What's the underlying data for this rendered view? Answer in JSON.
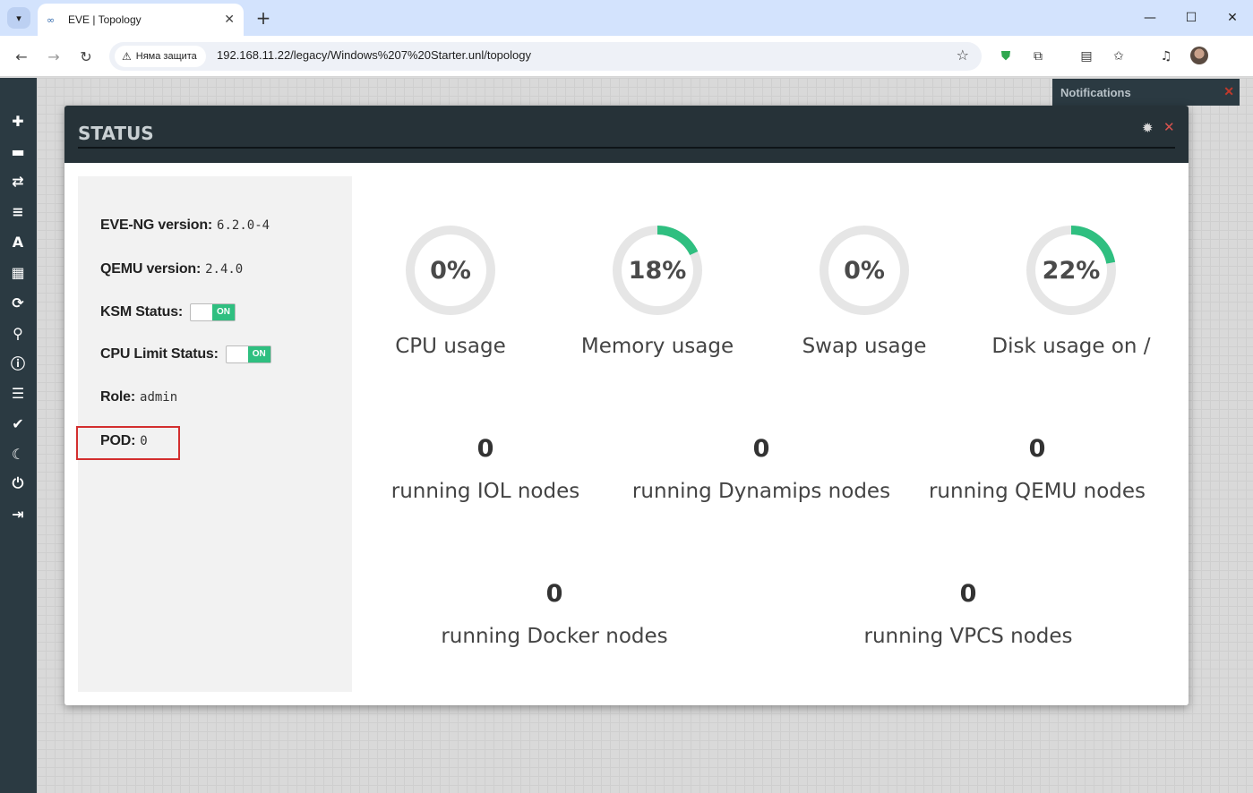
{
  "browser": {
    "tab_title": "EVE | Topology",
    "security_label": "Няма защита",
    "url": "192.168.11.22/legacy/Windows%207%20Starter.unl/topology"
  },
  "notifications": {
    "title": "Notifications"
  },
  "modal": {
    "title": "STATUS",
    "info": {
      "eve_label": "EVE-NG version:",
      "eve_value": "6.2.0-4",
      "qemu_label": "QEMU version:",
      "qemu_value": "2.4.0",
      "ksm_label": "KSM Status:",
      "ksm_toggle": "ON",
      "cpulimit_label": "CPU Limit Status:",
      "cpulimit_toggle": "ON",
      "role_label": "Role:",
      "role_value": "admin",
      "pod_label": "POD:",
      "pod_value": "0"
    },
    "gauges": [
      {
        "value_text": "0%",
        "percent": 0,
        "label": "CPU usage"
      },
      {
        "value_text": "18%",
        "percent": 18,
        "label": "Memory usage"
      },
      {
        "value_text": "0%",
        "percent": 0,
        "label": "Swap usage"
      },
      {
        "value_text": "22%",
        "percent": 22,
        "label": "Disk usage on /"
      }
    ],
    "counts": [
      {
        "value": "0",
        "label": "running IOL nodes"
      },
      {
        "value": "0",
        "label": "running Dynamips nodes"
      },
      {
        "value": "0",
        "label": "running QEMU nodes"
      },
      {
        "value": "0",
        "label": "running Docker nodes"
      },
      {
        "value": "0",
        "label": "running VPCS nodes"
      }
    ]
  },
  "colors": {
    "gauge_fill": "#2fbf80",
    "gauge_track": "#e6e6e6",
    "sidebar": "#2b3a42"
  }
}
